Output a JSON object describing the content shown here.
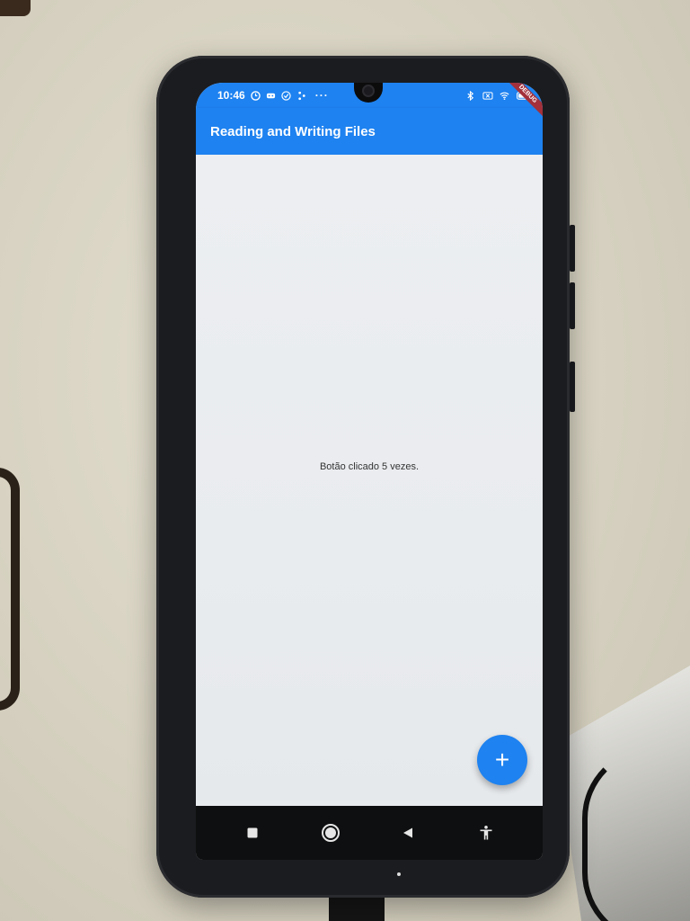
{
  "status_bar": {
    "time": "10:46",
    "more_indicator": "···",
    "left_icons": [
      "clock-icon",
      "gamepad-icon",
      "check-circle-icon",
      "share-icon"
    ],
    "right_icons": [
      "bluetooth-icon",
      "sim-off-icon",
      "wifi-icon",
      "battery-icon"
    ]
  },
  "debug_banner": "DEBUG",
  "app_bar": {
    "title": "Reading and Writing Files"
  },
  "body": {
    "counter_text": "Botão clicado 5 vezes."
  },
  "fab": {
    "label": "+",
    "icon": "add-icon"
  },
  "nav_bar": {
    "buttons": [
      "recents-square-icon",
      "home-circle-icon",
      "back-triangle-icon",
      "accessibility-icon"
    ]
  },
  "colors": {
    "primary": "#1e82f0",
    "background": "#e9ecef",
    "nav_bar": "#0e0f10",
    "text": "#333333"
  }
}
